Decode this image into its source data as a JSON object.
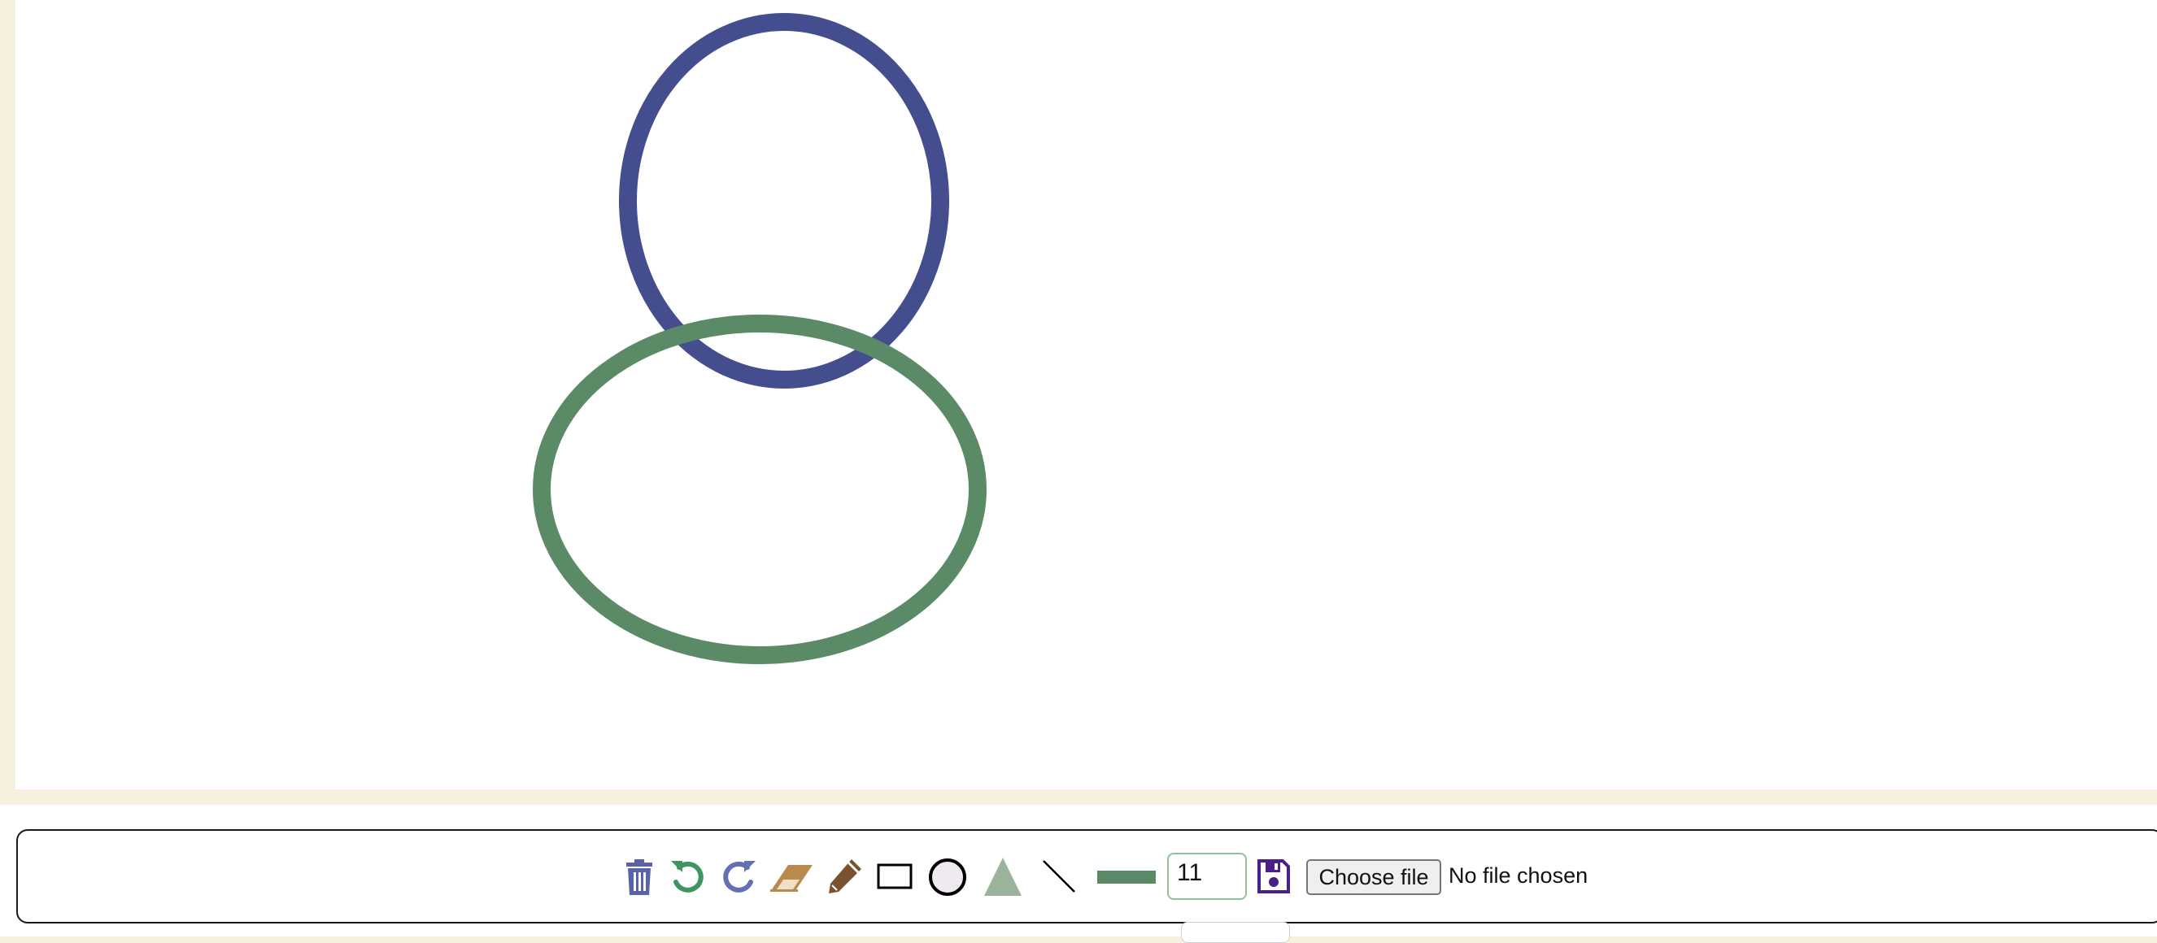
{
  "canvas": {
    "shapes": [
      {
        "type": "ellipse",
        "name": "blue-ellipse",
        "color": "#444e8f"
      },
      {
        "type": "ellipse",
        "name": "green-ellipse",
        "color": "#5a8a66"
      }
    ]
  },
  "toolbar": {
    "tools": [
      {
        "name": "trash-icon",
        "color": "#5a63a8"
      },
      {
        "name": "undo-icon",
        "color": "#3f9460"
      },
      {
        "name": "redo-icon",
        "color": "#6470b4"
      },
      {
        "name": "eraser-icon",
        "color": "#b88a4e"
      },
      {
        "name": "pencil-icon",
        "color": "#7a5230"
      },
      {
        "name": "rectangle-icon",
        "color": "#000000"
      },
      {
        "name": "circle-icon",
        "color": "#000000"
      },
      {
        "name": "triangle-icon",
        "color": "#9bb39b"
      },
      {
        "name": "line-icon",
        "color": "#000000"
      }
    ],
    "stroke_color": "#5a8a66",
    "stroke_width": "11",
    "save_icon_color": "#4a1f8c",
    "choose_file_label": "Choose file",
    "file_status": "No file chosen"
  }
}
